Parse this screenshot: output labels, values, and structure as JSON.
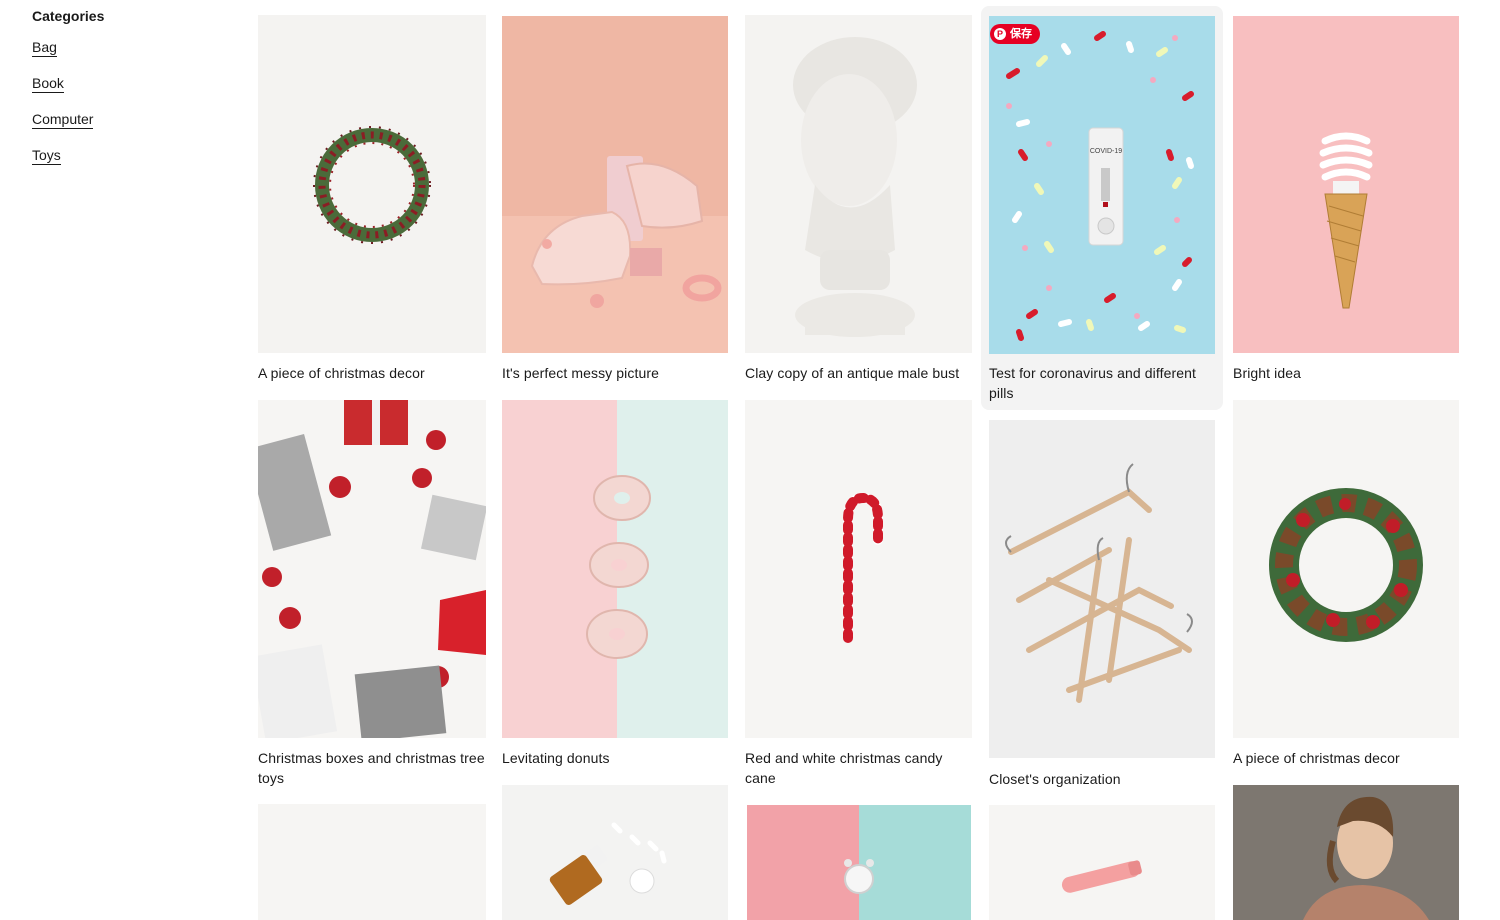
{
  "sidebar": {
    "title": "Categories",
    "items": [
      "Bag",
      "Book",
      "Computer",
      "Toys"
    ]
  },
  "save_button": {
    "label": "保存",
    "icon": "pinterest-icon"
  },
  "cards": [
    {
      "caption": "A piece of christmas decor"
    },
    {
      "caption": "It's perfect messy picture"
    },
    {
      "caption": "Clay copy of an antique male bust"
    },
    {
      "caption": "Test for coronavirus and different pills"
    },
    {
      "caption": "Bright idea"
    },
    {
      "caption": "Christmas boxes and christmas tree toys"
    },
    {
      "caption": "Levitating donuts"
    },
    {
      "caption": "Red and white christmas candy cane"
    },
    {
      "caption": "Closet's organization"
    },
    {
      "caption": "A piece of christmas decor"
    },
    {
      "caption": ""
    },
    {
      "caption": ""
    },
    {
      "caption": ""
    },
    {
      "caption": ""
    },
    {
      "caption": ""
    }
  ],
  "covid_test_label": "COVID-19",
  "colors": {
    "accent_red": "#e60023",
    "pink": "#f6c6bb",
    "light_blue": "#a8dcea",
    "mint": "#dff0ec"
  }
}
